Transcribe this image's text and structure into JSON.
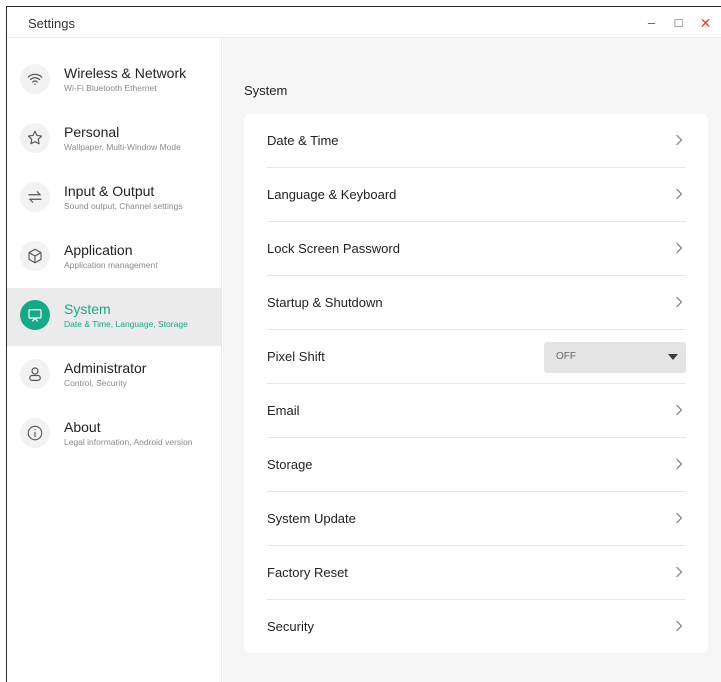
{
  "window": {
    "title": "Settings",
    "controls": {
      "minimize": "–",
      "maximize": "□",
      "close": "✕"
    }
  },
  "sidebar": {
    "items": [
      {
        "label": "Wireless & Network",
        "sub": "Wi-Fi Bluetooth Ethernet",
        "icon": "wifi-icon",
        "active": false
      },
      {
        "label": "Personal",
        "sub": "Wallpaper, Multi-Window Mode",
        "icon": "star-icon",
        "active": false
      },
      {
        "label": "Input & Output",
        "sub": "Sound output, Channel settings",
        "icon": "swap-arrows-icon",
        "active": false
      },
      {
        "label": "Application",
        "sub": "Application management",
        "icon": "cube-icon",
        "active": false
      },
      {
        "label": "System",
        "sub": "Date & Time, Language, Storage",
        "icon": "presentation-board-icon",
        "active": true
      },
      {
        "label": "Administrator",
        "sub": "Control, Security",
        "icon": "person-icon",
        "active": false
      },
      {
        "label": "About",
        "sub": "Legal information, Android version",
        "icon": "info-icon",
        "active": false
      }
    ]
  },
  "main": {
    "section_title": "System",
    "rows": [
      {
        "label": "Date & Time",
        "type": "link"
      },
      {
        "label": "Language & Keyboard",
        "type": "link"
      },
      {
        "label": "Lock Screen Password",
        "type": "link"
      },
      {
        "label": "Startup & Shutdown",
        "type": "link"
      },
      {
        "label": "Pixel Shift",
        "type": "dropdown",
        "value": "OFF"
      },
      {
        "label": "Email",
        "type": "link"
      },
      {
        "label": "Storage",
        "type": "link"
      },
      {
        "label": "System Update",
        "type": "link"
      },
      {
        "label": "Factory Reset",
        "type": "link"
      },
      {
        "label": "Security",
        "type": "link"
      }
    ]
  },
  "colors": {
    "accent": "#16a887",
    "active_bg": "#ebebeb",
    "content_bg": "#f5f5f5",
    "close": "#e0463f"
  }
}
